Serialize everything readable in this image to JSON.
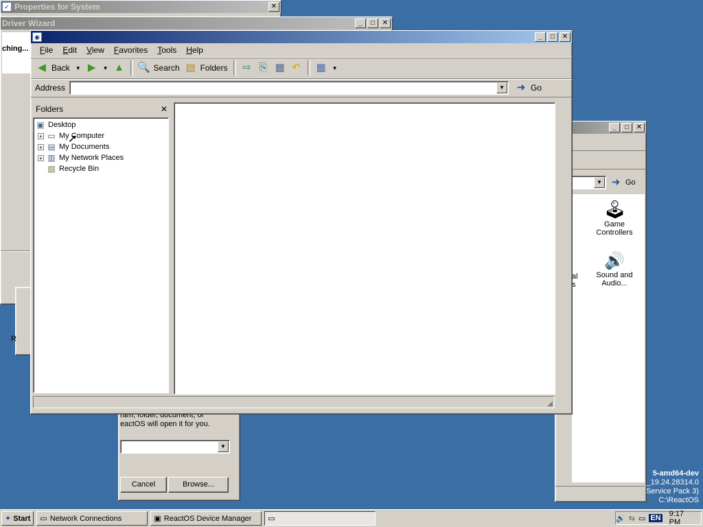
{
  "background_windows": {
    "properties_title": "Properties for System",
    "driver_wizard_title": "Driver Wizard",
    "driver_wizard_body": "ching...",
    "stray_letter": "R",
    "open_dialog_text_line1": "ram, folder, document, or",
    "open_dialog_text_line2": "eactOS will open it for you.",
    "cancel_label": "Cancel",
    "browse_label": "Browse..."
  },
  "control_panel": {
    "go_label": "Go",
    "partial_label_1": "al",
    "partial_label_2": "s",
    "items": [
      {
        "icon": "joystick-icon",
        "label_line1": "Game",
        "label_line2": "Controllers"
      },
      {
        "icon": "speaker-icon",
        "label_line1": "Sound and",
        "label_line2": "Audio..."
      }
    ]
  },
  "explorer": {
    "menu": [
      "File",
      "Edit",
      "View",
      "Favorites",
      "Tools",
      "Help"
    ],
    "toolbar": {
      "back_label": "Back",
      "search_label": "Search",
      "folders_label": "Folders"
    },
    "address": {
      "label": "Address",
      "value": "",
      "go_label": "Go"
    },
    "folders_pane": {
      "title": "Folders",
      "tree": [
        {
          "label": "Desktop",
          "icon": "desktop-icon"
        },
        {
          "label": "My Computer",
          "icon": "computer-icon"
        },
        {
          "label": "My Documents",
          "icon": "documents-icon"
        },
        {
          "label": "My Network Places",
          "icon": "network-icon"
        },
        {
          "label": "Recycle Bin",
          "icon": "recycle-bin-icon"
        }
      ]
    }
  },
  "desktop_info": {
    "line1": "5-amd64-dev",
    "line2": "_19.24.28314.0",
    "line3": "Service Pack 3)",
    "line4": "C:\\ReactOS"
  },
  "taskbar": {
    "start_label": "Start",
    "buttons": [
      "Network Connections",
      "ReactOS Device Manager",
      ""
    ],
    "language": "EN",
    "clock": "9:17 PM"
  },
  "colors": {
    "desktop": "#3a6ea5",
    "active_title_start": "#0a246a",
    "active_title_end": "#a6caf0",
    "window_face": "#d4d0c8"
  }
}
